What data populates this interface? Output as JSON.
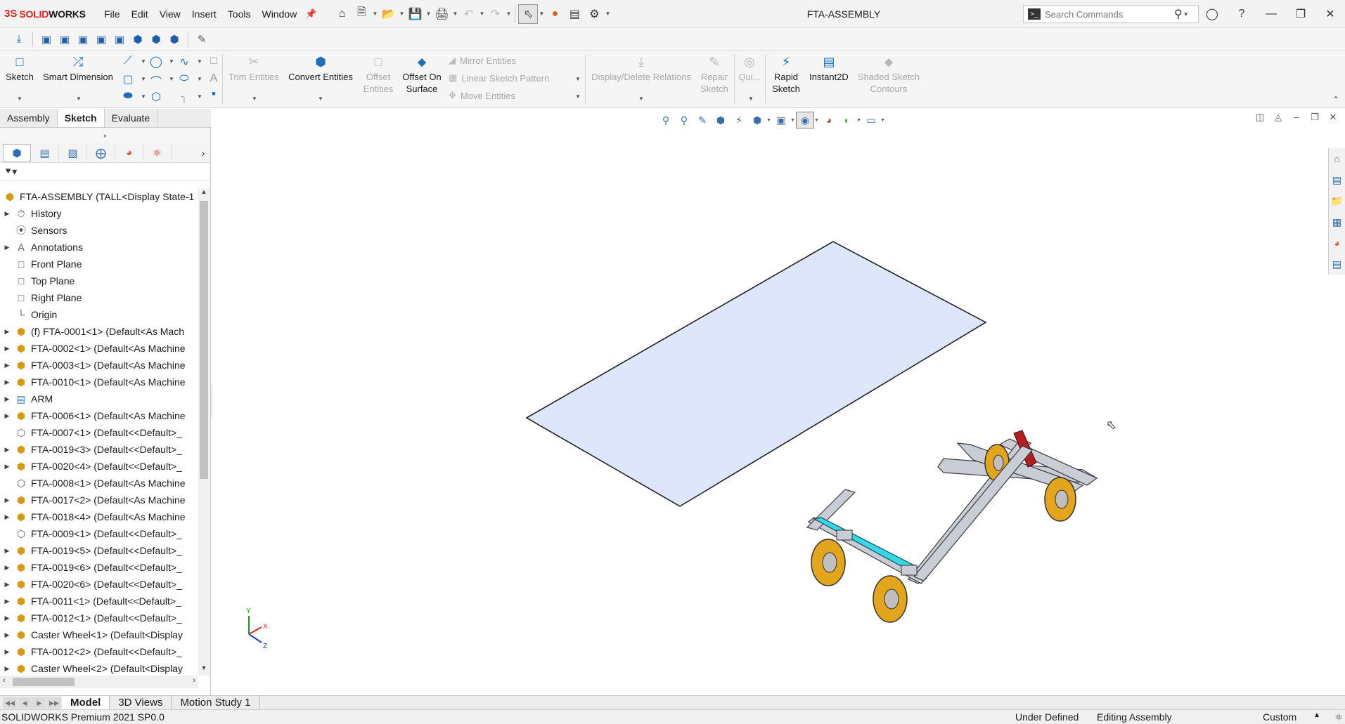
{
  "app": {
    "brand_prefix": "3S",
    "brand_s": "SOLID",
    "brand_rest": "WORKS",
    "doc_title": "FTA-ASSEMBLY"
  },
  "menus": [
    "File",
    "Edit",
    "View",
    "Insert",
    "Tools",
    "Window"
  ],
  "search": {
    "placeholder": "Search Commands"
  },
  "ribbon": {
    "sketch": "Sketch",
    "smart_dimension": "Smart Dimension",
    "trim_entities": "Trim Entities",
    "convert_entities": "Convert Entities",
    "offset_entities_1": "Offset",
    "offset_entities_2": "Entities",
    "offset_surface_1": "Offset On",
    "offset_surface_2": "Surface",
    "mirror_entities": "Mirror Entities",
    "linear_pattern": "Linear Sketch Pattern",
    "move_entities": "Move Entities",
    "display_relations": "Display/Delete Relations",
    "repair_sketch_1": "Repair",
    "repair_sketch_2": "Sketch",
    "quick_snaps": "Qui...",
    "rapid_sketch_1": "Rapid",
    "rapid_sketch_2": "Sketch",
    "instant2d": "Instant2D",
    "shaded_contours_1": "Shaded Sketch",
    "shaded_contours_2": "Contours"
  },
  "command_tabs": [
    "Assembly",
    "Sketch",
    "Evaluate"
  ],
  "tree": {
    "root": "FTA-ASSEMBLY  (TALL<Display State-1",
    "items": [
      {
        "label": "History",
        "icon": "history-icon",
        "expand": true,
        "type": "gray"
      },
      {
        "label": "Sensors",
        "icon": "sensors-icon",
        "expand": false,
        "type": "gray"
      },
      {
        "label": "Annotations",
        "icon": "annotations-icon",
        "expand": true,
        "type": "gray"
      },
      {
        "label": "Front Plane",
        "icon": "plane-icon",
        "expand": false,
        "type": "gray"
      },
      {
        "label": "Top Plane",
        "icon": "plane-icon",
        "expand": false,
        "type": "gray"
      },
      {
        "label": "Right Plane",
        "icon": "plane-icon",
        "expand": false,
        "type": "gray"
      },
      {
        "label": "Origin",
        "icon": "origin-icon",
        "expand": false,
        "type": "gray"
      },
      {
        "label": "(f) FTA-0001<1> (Default<As Mach",
        "icon": "part-icon",
        "expand": true,
        "type": "part"
      },
      {
        "label": "FTA-0002<1> (Default<As Machine",
        "icon": "part-icon",
        "expand": true,
        "type": "part"
      },
      {
        "label": "FTA-0003<1> (Default<As Machine",
        "icon": "part-icon",
        "expand": true,
        "type": "part"
      },
      {
        "label": "FTA-0010<1> (Default<As Machine",
        "icon": "part-icon",
        "expand": true,
        "type": "part"
      },
      {
        "label": "ARM",
        "icon": "folder-icon",
        "expand": true,
        "type": "folder"
      },
      {
        "label": "FTA-0006<1> (Default<As Machine",
        "icon": "part-icon",
        "expand": true,
        "type": "part"
      },
      {
        "label": "FTA-0007<1> (Default<<Default>_",
        "icon": "part-outline-icon",
        "expand": false,
        "type": "gray"
      },
      {
        "label": "FTA-0019<3> (Default<<Default>_",
        "icon": "part-icon",
        "expand": true,
        "type": "part"
      },
      {
        "label": "FTA-0020<4> (Default<<Default>_",
        "icon": "part-icon",
        "expand": true,
        "type": "part"
      },
      {
        "label": "FTA-0008<1> (Default<As Machine",
        "icon": "part-outline-icon",
        "expand": false,
        "type": "gray"
      },
      {
        "label": "FTA-0017<2> (Default<As Machine",
        "icon": "part-icon",
        "expand": true,
        "type": "part"
      },
      {
        "label": "FTA-0018<4> (Default<As Machine",
        "icon": "part-icon",
        "expand": true,
        "type": "part"
      },
      {
        "label": "FTA-0009<1> (Default<<Default>_",
        "icon": "part-outline-icon",
        "expand": false,
        "type": "gray"
      },
      {
        "label": "FTA-0019<5> (Default<<Default>_",
        "icon": "part-icon",
        "expand": true,
        "type": "part"
      },
      {
        "label": "FTA-0019<6> (Default<<Default>_",
        "icon": "part-icon",
        "expand": true,
        "type": "part"
      },
      {
        "label": "FTA-0020<6> (Default<<Default>_",
        "icon": "part-icon",
        "expand": true,
        "type": "part"
      },
      {
        "label": "FTA-0011<1> (Default<<Default>_",
        "icon": "part-icon",
        "expand": true,
        "type": "part"
      },
      {
        "label": "FTA-0012<1> (Default<<Default>_",
        "icon": "part-icon",
        "expand": true,
        "type": "part"
      },
      {
        "label": "Caster Wheel<1> (Default<Display",
        "icon": "assembly-icon",
        "expand": true,
        "type": "asm"
      },
      {
        "label": "FTA-0012<2> (Default<<Default>_",
        "icon": "part-icon",
        "expand": true,
        "type": "part"
      },
      {
        "label": "Caster Wheel<2> (Default<Display",
        "icon": "assembly-icon",
        "expand": true,
        "type": "asm"
      }
    ]
  },
  "triad": {
    "x": "X",
    "y": "Y",
    "z": "Z"
  },
  "bottom_tabs": [
    "Model",
    "3D Views",
    "Motion Study 1"
  ],
  "status": {
    "version": "SOLIDWORKS Premium 2021 SP0.0",
    "sketch_state": "Under Defined",
    "mode": "Editing Assembly",
    "units": "Custom"
  },
  "colors": {
    "tabletop": "#dde6fb",
    "frame": "#c9ced6",
    "wheel": "#e3a51c",
    "accent_bar": "#35d8e6",
    "cylinder": "#b41e1e"
  }
}
